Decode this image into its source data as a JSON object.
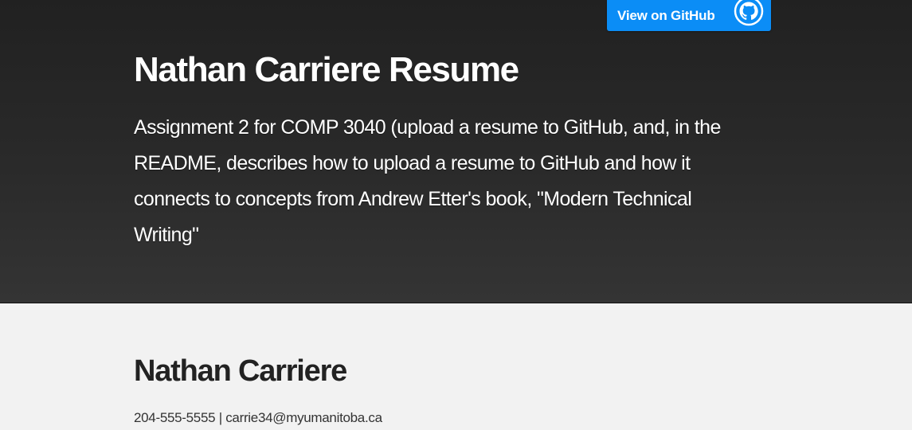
{
  "header": {
    "github_button_label": "View on GitHub",
    "github_icon": "github-octocat-icon",
    "project_name": "Nathan Carriere Resume",
    "project_tagline": "Assignment 2 for COMP 3040 (upload a resume to GitHub, and, in the README, describes how to upload a resume to GitHub and how it connects to concepts from Andrew Etter's book, \"Modern Technical Writing\""
  },
  "main": {
    "name": "Nathan Carriere",
    "contact": "204-555-5555 | carrie34@myumanitoba.ca"
  },
  "colors": {
    "header_bg": "#2a2a2a",
    "button_bg": "#0b8df6",
    "page_bg": "#f2f2f2"
  }
}
